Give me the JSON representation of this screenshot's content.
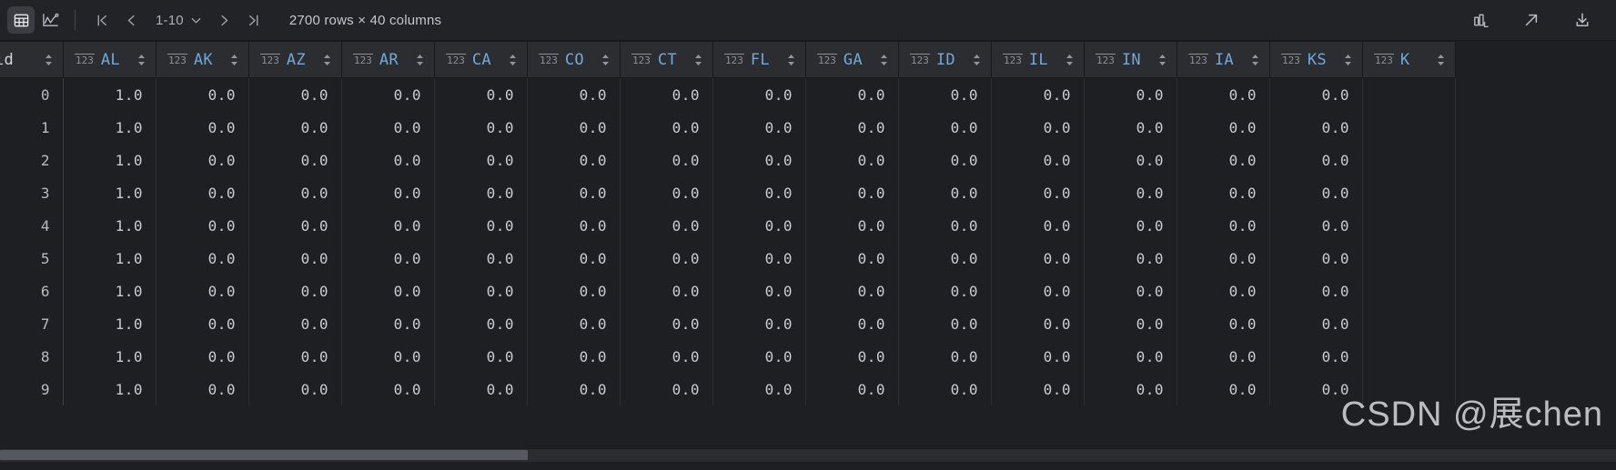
{
  "toolbar": {
    "view_buttons": [
      {
        "name": "table-view-icon",
        "label": "Table view",
        "active": true
      },
      {
        "name": "chart-view-icon",
        "label": "Chart view",
        "active": false
      }
    ],
    "pagination": {
      "first_label": "First page",
      "prev_label": "Previous page",
      "range": "1-10",
      "next_label": "Next page",
      "last_label": "Last page"
    },
    "dimensions": "2700 rows × 40 columns",
    "right_buttons": [
      {
        "name": "bar-chart-icon",
        "label": "Summary charts"
      },
      {
        "name": "open-external-icon",
        "label": "Open in new window"
      },
      {
        "name": "download-icon",
        "label": "Download data"
      }
    ]
  },
  "grid": {
    "index_column": {
      "label": "id",
      "type": ""
    },
    "columns": [
      {
        "label": "AL",
        "type": "123"
      },
      {
        "label": "AK",
        "type": "123"
      },
      {
        "label": "AZ",
        "type": "123"
      },
      {
        "label": "AR",
        "type": "123"
      },
      {
        "label": "CA",
        "type": "123"
      },
      {
        "label": "CO",
        "type": "123"
      },
      {
        "label": "CT",
        "type": "123"
      },
      {
        "label": "FL",
        "type": "123"
      },
      {
        "label": "GA",
        "type": "123"
      },
      {
        "label": "ID",
        "type": "123"
      },
      {
        "label": "IL",
        "type": "123"
      },
      {
        "label": "IN",
        "type": "123"
      },
      {
        "label": "IA",
        "type": "123"
      },
      {
        "label": "KS",
        "type": "123"
      },
      {
        "label": "K",
        "type": "123"
      }
    ],
    "rows": [
      {
        "id": "0",
        "values": [
          "1.0",
          "0.0",
          "0.0",
          "0.0",
          "0.0",
          "0.0",
          "0.0",
          "0.0",
          "0.0",
          "0.0",
          "0.0",
          "0.0",
          "0.0",
          "0.0",
          ""
        ]
      },
      {
        "id": "1",
        "values": [
          "1.0",
          "0.0",
          "0.0",
          "0.0",
          "0.0",
          "0.0",
          "0.0",
          "0.0",
          "0.0",
          "0.0",
          "0.0",
          "0.0",
          "0.0",
          "0.0",
          ""
        ]
      },
      {
        "id": "2",
        "values": [
          "1.0",
          "0.0",
          "0.0",
          "0.0",
          "0.0",
          "0.0",
          "0.0",
          "0.0",
          "0.0",
          "0.0",
          "0.0",
          "0.0",
          "0.0",
          "0.0",
          ""
        ]
      },
      {
        "id": "3",
        "values": [
          "1.0",
          "0.0",
          "0.0",
          "0.0",
          "0.0",
          "0.0",
          "0.0",
          "0.0",
          "0.0",
          "0.0",
          "0.0",
          "0.0",
          "0.0",
          "0.0",
          ""
        ]
      },
      {
        "id": "4",
        "values": [
          "1.0",
          "0.0",
          "0.0",
          "0.0",
          "0.0",
          "0.0",
          "0.0",
          "0.0",
          "0.0",
          "0.0",
          "0.0",
          "0.0",
          "0.0",
          "0.0",
          ""
        ]
      },
      {
        "id": "5",
        "values": [
          "1.0",
          "0.0",
          "0.0",
          "0.0",
          "0.0",
          "0.0",
          "0.0",
          "0.0",
          "0.0",
          "0.0",
          "0.0",
          "0.0",
          "0.0",
          "0.0",
          ""
        ]
      },
      {
        "id": "6",
        "values": [
          "1.0",
          "0.0",
          "0.0",
          "0.0",
          "0.0",
          "0.0",
          "0.0",
          "0.0",
          "0.0",
          "0.0",
          "0.0",
          "0.0",
          "0.0",
          "0.0",
          ""
        ]
      },
      {
        "id": "7",
        "values": [
          "1.0",
          "0.0",
          "0.0",
          "0.0",
          "0.0",
          "0.0",
          "0.0",
          "0.0",
          "0.0",
          "0.0",
          "0.0",
          "0.0",
          "0.0",
          "0.0",
          ""
        ]
      },
      {
        "id": "8",
        "values": [
          "1.0",
          "0.0",
          "0.0",
          "0.0",
          "0.0",
          "0.0",
          "0.0",
          "0.0",
          "0.0",
          "0.0",
          "0.0",
          "0.0",
          "0.0",
          "0.0",
          ""
        ]
      },
      {
        "id": "9",
        "values": [
          "1.0",
          "0.0",
          "0.0",
          "0.0",
          "0.0",
          "0.0",
          "0.0",
          "0.0",
          "0.0",
          "0.0",
          "0.0",
          "0.0",
          "0.0",
          "0.0",
          ""
        ]
      }
    ]
  },
  "watermark": "CSDN @展chen",
  "colors": {
    "background": "#1e1f22",
    "toolbar_bg": "#222326",
    "header_bg": "#2b2d31",
    "column_name": "#6fa8dc",
    "cell_text": "#c8ccd3",
    "scrollbar_thumb": "#55585f"
  }
}
